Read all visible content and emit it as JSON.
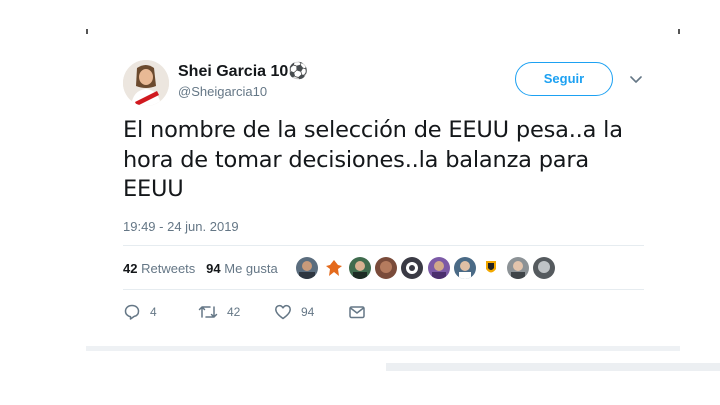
{
  "tweet": {
    "author_name": "Shei Garcia 10⚽",
    "author_handle": "@Sheigarcia10",
    "follow_label": "Seguir",
    "text_lines": [
      "El nombre de la selección de EEUU pesa..a la",
      "hora de tomar decisiones..la balanza para",
      "EEUU"
    ],
    "timestamp": "19:49 - 24 jun. 2019",
    "stats": {
      "retweets_count": "42",
      "retweets_label": "Retweets",
      "likes_count": "94",
      "likes_label": "Me gusta"
    },
    "likers": [
      {
        "name": "liker-avatar-1",
        "color": "#5b6d7e"
      },
      {
        "name": "liker-avatar-2",
        "color": "#e46a1c"
      },
      {
        "name": "liker-avatar-3",
        "color": "#3f6b4d"
      },
      {
        "name": "liker-avatar-4",
        "color": "#7a4b3a"
      },
      {
        "name": "liker-avatar-5",
        "color": "#3a3a44"
      },
      {
        "name": "liker-avatar-6",
        "color": "#7c5aa6"
      },
      {
        "name": "liker-avatar-7",
        "color": "#4a6a86"
      },
      {
        "name": "liker-avatar-8",
        "color": "#f2a800"
      },
      {
        "name": "liker-avatar-9",
        "color": "#8c9296"
      },
      {
        "name": "liker-avatar-10",
        "color": "#555a5e"
      }
    ],
    "actions": {
      "reply_count": "4",
      "retweet_count": "42",
      "like_count": "94"
    }
  },
  "colors": {
    "accent": "#1da1f2",
    "secondary_text": "#657786",
    "primary_text": "#14171a",
    "divider": "#e6ecf0"
  }
}
